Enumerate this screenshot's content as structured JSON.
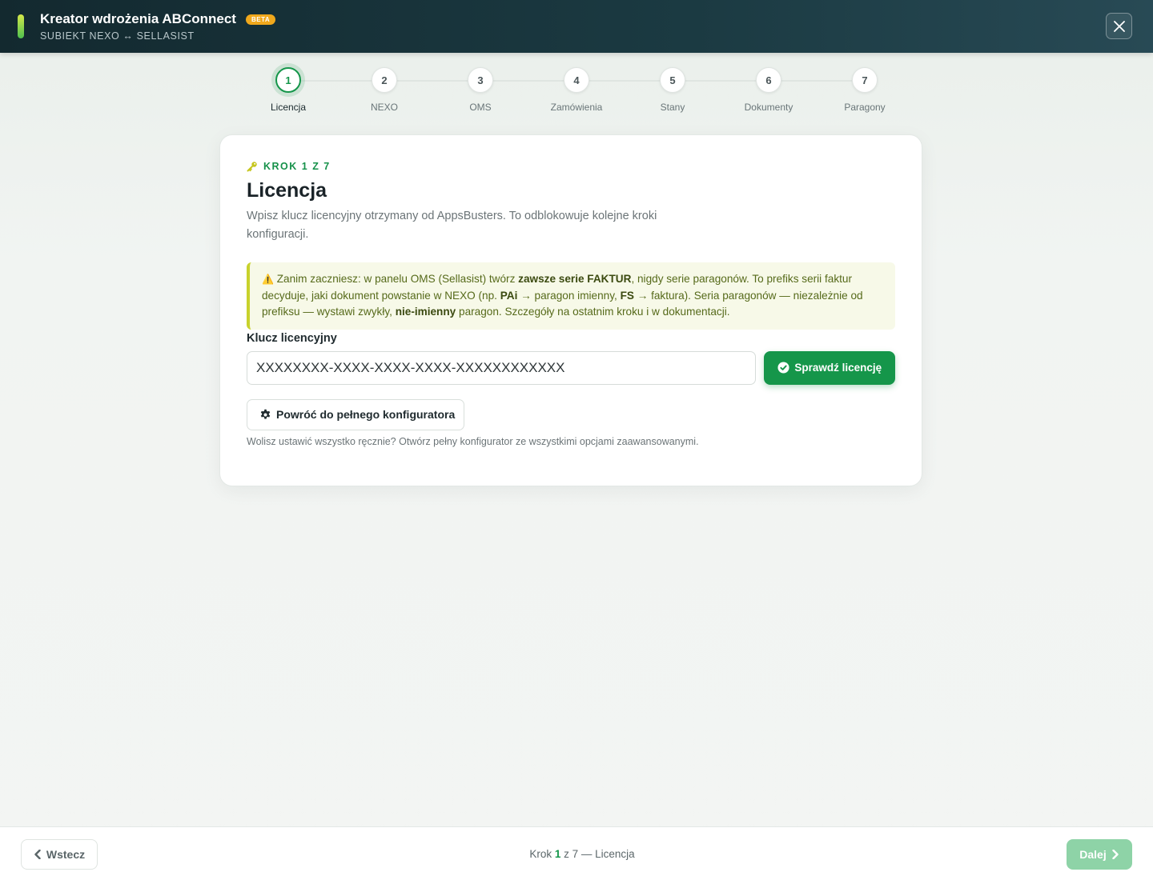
{
  "header": {
    "title": "Kreator wdrożenia ABConnect",
    "badge": "BETA",
    "subtitle": "SUBIEKT NEXO ↔ SELLASIST",
    "close_icon": "close-icon"
  },
  "stepper": {
    "steps": [
      {
        "number": "1",
        "label": "Licencja",
        "active": true
      },
      {
        "number": "2",
        "label": "NEXO",
        "active": false
      },
      {
        "number": "3",
        "label": "OMS",
        "active": false
      },
      {
        "number": "4",
        "label": "Zamówienia",
        "active": false
      },
      {
        "number": "5",
        "label": "Stany",
        "active": false
      },
      {
        "number": "6",
        "label": "Dokumenty",
        "active": false
      },
      {
        "number": "7",
        "label": "Paragony",
        "active": false
      }
    ]
  },
  "card": {
    "kicker": "KROK 1 Z 7",
    "kicker_icon": "key-icon",
    "title": "Licencja",
    "description": "Wpisz klucz licencyjny otrzymany od AppsBusters. To odblokowuje kolejne kroki konfiguracji.",
    "alert": {
      "icon": "⚠️",
      "t1": "Zanim zaczniesz: w panelu OMS (Sellasist) twórz ",
      "b1": "zawsze serie FAKTUR",
      "t2": ", nigdy serie paragonów. To prefiks serii faktur decyduje, jaki dokument powstanie w NEXO (np. ",
      "b2": "PAi",
      "t3": " → paragon imienny, ",
      "b3": "FS",
      "t4": " → faktura). Seria paragonów — niezależnie od prefiksu — wystawi zwykły, ",
      "b4": "nie-imienny",
      "t5": " paragon. Szczegóły na ostatnim kroku i w dokumentacji."
    },
    "field_label": "Klucz licencyjny",
    "input_placeholder": "XXXXXXXX-XXXX-XXXX-XXXX-XXXXXXXXXXXX",
    "input_value": "",
    "check_button": "Sprawdź licencję",
    "back_full_button": "Powróć do pełnego konfiguratora",
    "hint": "Wolisz ustawić wszystko ręcznie? Otwórz pełny konfigurator ze wszystkimi opcjami zaawansowanymi."
  },
  "footer": {
    "back_button": "Wstecz",
    "status_prefix": "Krok ",
    "status_current": "1",
    "status_suffix": " z 7 — Licencja",
    "next_button": "Dalej"
  },
  "colors": {
    "accent": "#15964a",
    "header_bg": "#1b3a42",
    "beta": "#f0a81c",
    "alert_border": "#c8d22c",
    "next_disabled": "#8ed3a7"
  }
}
